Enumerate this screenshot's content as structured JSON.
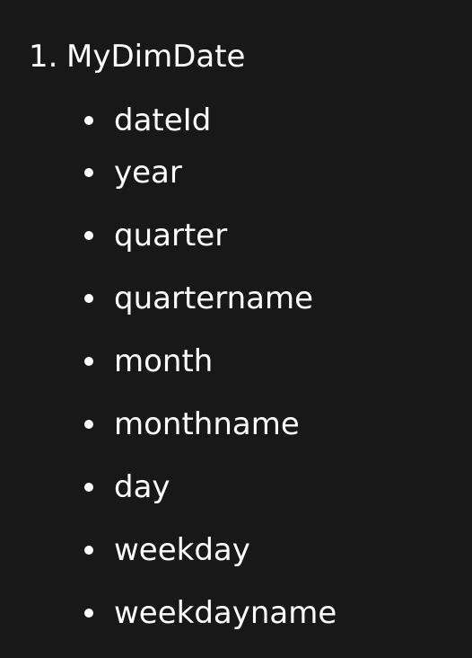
{
  "document": {
    "ordered_list": [
      {
        "number": "1.",
        "title": "MyDimDate",
        "fields": [
          "dateId",
          "year",
          "quarter",
          "quartername",
          "month",
          "monthname",
          "day",
          "weekday",
          "weekdayname"
        ]
      }
    ]
  },
  "colors": {
    "background": "#181818",
    "text": "#ffffff"
  }
}
